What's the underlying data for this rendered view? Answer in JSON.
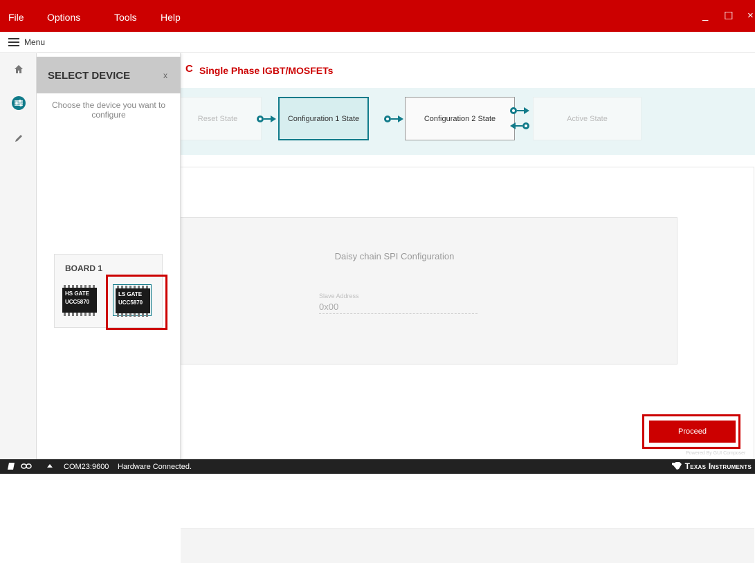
{
  "menubar": {
    "items": [
      "File",
      "Options",
      "Tools",
      "Help"
    ],
    "minimize": "_",
    "maximize": "☐",
    "close": "×"
  },
  "toolbar": {
    "menu_label": "Menu"
  },
  "panel": {
    "title": "SELECT DEVICE",
    "close": "x",
    "description": "Choose the device you want to configure",
    "board_title": "BOARD 1",
    "chips": [
      {
        "label": "HS GATE",
        "part": "UCC5870",
        "selected": false
      },
      {
        "label": "LS GATE",
        "part": "UCC5870",
        "selected": true
      }
    ]
  },
  "header": {
    "title": "Single Phase IGBT/MOSFETs",
    "refresh_icon": "C"
  },
  "states": [
    "Reset State",
    "Configuration 1 State",
    "Configuration 2 State",
    "Active State"
  ],
  "spi": {
    "title": "Daisy chain SPI Configuration",
    "slave_label": "Slave Address",
    "slave_value": "0x00"
  },
  "actions": {
    "proceed": "Proceed"
  },
  "powered": "Powered By GUI Composer",
  "status": {
    "port": "COM23:9600",
    "text": "Hardware Connected.",
    "brand": "Texas Instruments"
  },
  "colors": {
    "brand": "#cc0000",
    "accent": "#117b8a"
  }
}
